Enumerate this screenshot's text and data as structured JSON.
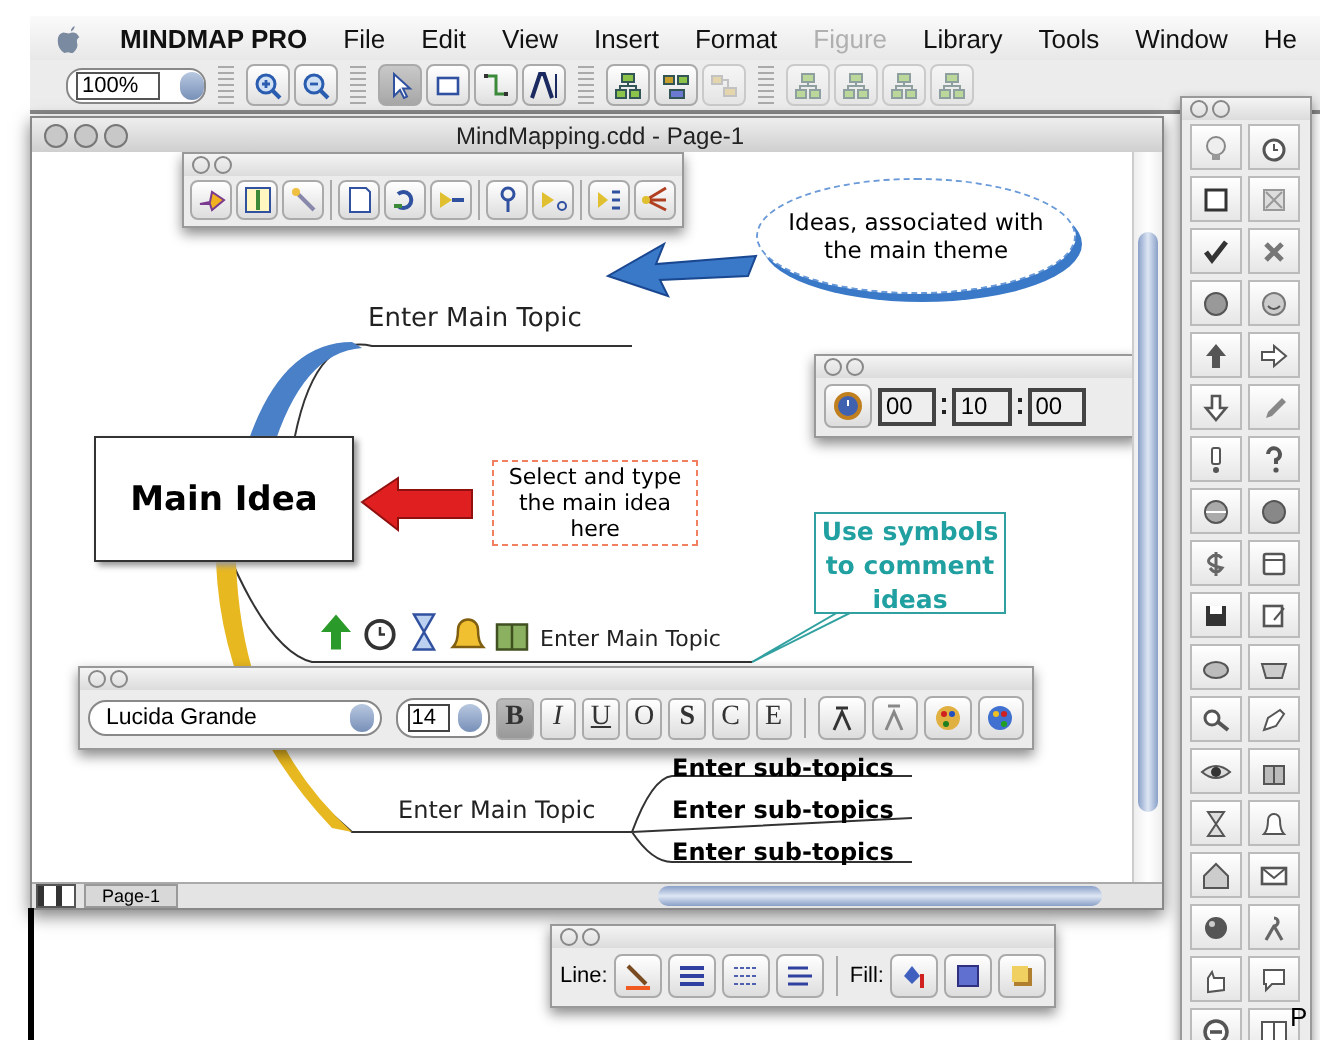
{
  "menu_bar": {
    "app_name": "MINDMAP PRO",
    "items": [
      {
        "label": "File",
        "disabled": false
      },
      {
        "label": "Edit",
        "disabled": false
      },
      {
        "label": "View",
        "disabled": false
      },
      {
        "label": "Insert",
        "disabled": false
      },
      {
        "label": "Format",
        "disabled": false
      },
      {
        "label": "Figure",
        "disabled": true
      },
      {
        "label": "Library",
        "disabled": false
      },
      {
        "label": "Tools",
        "disabled": false
      },
      {
        "label": "Window",
        "disabled": false
      },
      {
        "label": "He",
        "disabled": false
      }
    ]
  },
  "toolbar": {
    "zoom": "100%",
    "groups": [
      [
        {
          "kind": "zoomin",
          "selected": false,
          "disabled": false
        },
        {
          "kind": "zoomout",
          "selected": false,
          "disabled": false
        }
      ],
      [
        {
          "kind": "pointer",
          "selected": true,
          "disabled": false
        },
        {
          "kind": "shape",
          "selected": false,
          "disabled": false
        },
        {
          "kind": "connector",
          "selected": false,
          "disabled": false
        },
        {
          "kind": "text",
          "selected": false,
          "disabled": false
        }
      ],
      [
        {
          "kind": "topic",
          "selected": false,
          "disabled": false
        },
        {
          "kind": "subtopic",
          "selected": false,
          "disabled": false
        },
        {
          "kind": "detach",
          "selected": false,
          "disabled": true
        }
      ],
      [
        {
          "kind": "topic",
          "selected": false,
          "disabled": true
        },
        {
          "kind": "topic",
          "selected": false,
          "disabled": true
        },
        {
          "kind": "topic",
          "selected": false,
          "disabled": true
        },
        {
          "kind": "topic",
          "selected": false,
          "disabled": true
        }
      ]
    ]
  },
  "document": {
    "title": "MindMapping.cdd - Page-1",
    "map": {
      "central": "Main Idea",
      "topics": [
        {
          "label": "Enter Main Topic"
        },
        {
          "label": "Enter Main Topic"
        },
        {
          "label": "Enter Main Topic",
          "subtopics": [
            "Enter sub-topics",
            "Enter sub-topics",
            "Enter sub-topics"
          ]
        }
      ],
      "callouts": [
        {
          "kind": "ellipse",
          "text": "Ideas, associated with the main theme"
        },
        {
          "kind": "dashed",
          "text": "Select and type the main idea here"
        },
        {
          "kind": "boxed",
          "text": "Use symbols to comment ideas"
        }
      ]
    },
    "timer": [
      "00",
      "10",
      "00"
    ],
    "text_palette": {
      "font": "Lucida Grande",
      "size": "14",
      "styles": [
        {
          "label": "B",
          "selected": true
        },
        {
          "label": "I",
          "selected": false
        },
        {
          "label": "U",
          "selected": false
        },
        {
          "label": "O",
          "selected": false
        },
        {
          "label": "S",
          "selected": false
        },
        {
          "label": "C",
          "selected": false
        },
        {
          "label": "E",
          "selected": false
        }
      ]
    },
    "page_tab": "Page-1"
  },
  "line_fill_palette": {
    "line_label": "Line:",
    "fill_label": "Fill:"
  },
  "edge_text": "P"
}
